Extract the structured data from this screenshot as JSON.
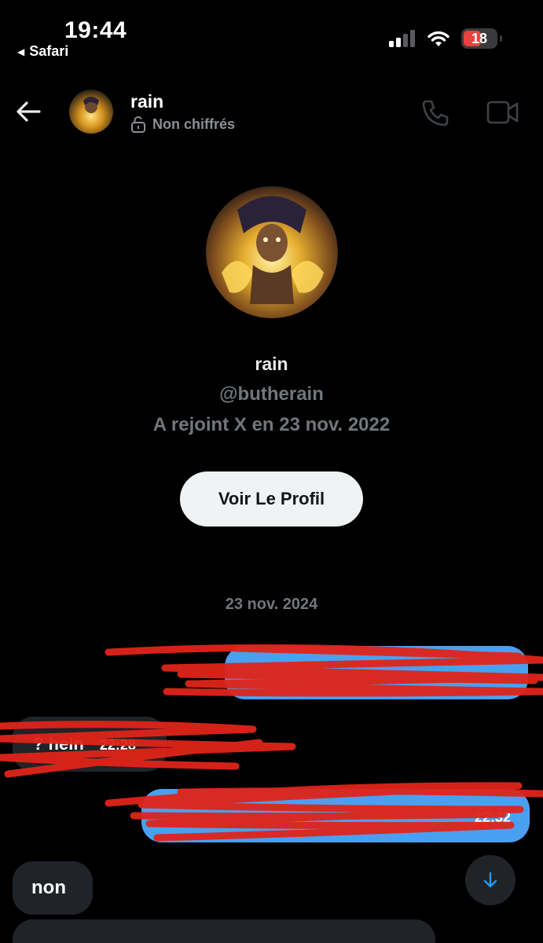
{
  "status_bar": {
    "time": "19:44",
    "back_app": "Safari",
    "battery": "18"
  },
  "header": {
    "name": "rain",
    "encryption": "Non chiffrés"
  },
  "profile": {
    "name": "rain",
    "handle": "@butherain",
    "joined": "A rejoint X en 23 nov. 2022",
    "view_button": "Voir Le Profil"
  },
  "conversation": {
    "date": "23 nov. 2024",
    "messages": [
      {
        "direction": "sent",
        "text": "",
        "time": ""
      },
      {
        "direction": "received",
        "text": "? hein",
        "time": "22:28"
      },
      {
        "direction": "sent",
        "text": "",
        "time": "22:32"
      },
      {
        "direction": "received",
        "text": "non",
        "time": ""
      },
      {
        "direction": "received",
        "text": "",
        "time": ""
      }
    ]
  },
  "colors": {
    "background": "#000000",
    "sent_bubble": "#4aa0f0",
    "received_bubble": "#202327",
    "muted_text": "#71767b",
    "scribble_red": "#e0241a"
  },
  "icons": [
    "back-arrow-icon",
    "lock-icon",
    "phone-icon",
    "video-icon",
    "arrow-down-icon",
    "wifi-icon",
    "signal-icon",
    "battery-icon"
  ]
}
